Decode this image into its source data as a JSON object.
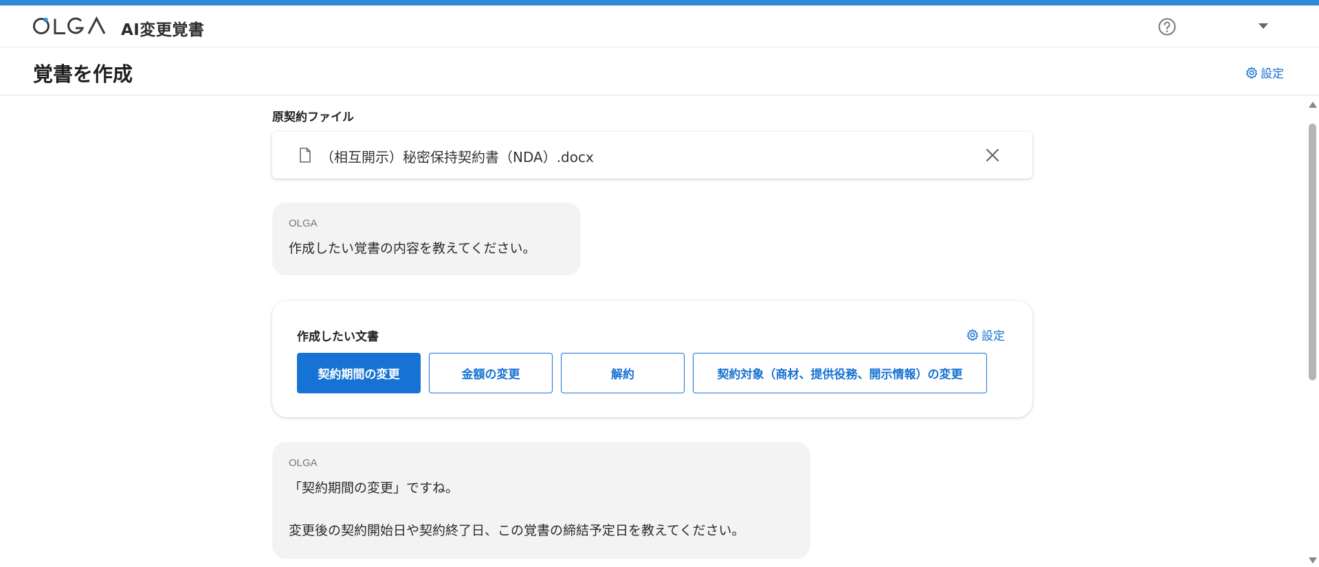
{
  "app": {
    "logo_text": "OLGA",
    "product_name": "AI変更覚書"
  },
  "header": {
    "title": "覚書を作成",
    "settings_label": "設定"
  },
  "original_file": {
    "label": "原契約ファイル",
    "file_name": "（相互開示）秘密保持契約書（NDA）.docx"
  },
  "messages": [
    {
      "sender": "OLGA",
      "text": "作成したい覚書の内容を教えてください。"
    },
    {
      "sender": "OLGA",
      "lines": [
        "「契約期間の変更」ですね。",
        "変更後の契約開始日や契約終了日、この覚書の締結予定日を教えてください。"
      ]
    }
  ],
  "document_choice": {
    "label": "作成したい文書",
    "settings_label": "設定",
    "options": [
      {
        "label": "契約期間の変更",
        "selected": true
      },
      {
        "label": "金額の変更",
        "selected": false
      },
      {
        "label": "解約",
        "selected": false
      },
      {
        "label": "契約対象（商材、提供役務、開示情報）の変更",
        "selected": false
      }
    ]
  },
  "icons": {
    "help": "help-circle-icon",
    "file": "file-icon",
    "close": "close-icon",
    "settings": "gear-icon",
    "dropdown": "chevron-down-icon"
  },
  "colors": {
    "accent": "#1672d4",
    "top_line": "#2f8bd8",
    "bubble_bg": "#f3f3f3"
  }
}
